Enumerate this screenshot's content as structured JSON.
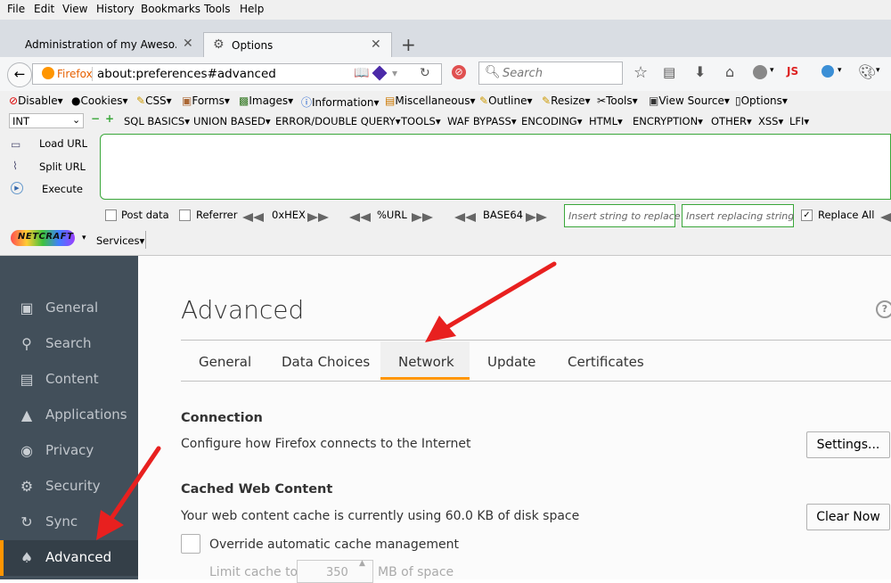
{
  "menu": [
    "File",
    "Edit",
    "View",
    "History",
    "Bookmarks",
    "Tools",
    "Help"
  ],
  "tabs": [
    {
      "title": "Administration of my Aweso...",
      "close": "✕"
    },
    {
      "title": "Options",
      "close": "✕"
    }
  ],
  "new_tab": "+",
  "nav": {
    "identity": "Firefox",
    "url": "about:preferences#advanced",
    "search_placeholder": "Search"
  },
  "webdev": [
    "Disable▾",
    "Cookies▾",
    "CSS▾",
    "Forms▾",
    "Images▾",
    "Information▾",
    "Miscellaneous▾",
    "Outline▾",
    "Resize▾",
    "Tools▾",
    "View Source▾",
    "Options▾"
  ],
  "hackbar": {
    "select_value": "INT",
    "menus": [
      "SQL BASICS▾",
      "UNION BASED▾",
      "ERROR/DOUBLE QUERY▾",
      "TOOLS▾",
      "WAF BYPASS▾",
      "ENCODING▾",
      "HTML▾",
      "ENCRYPTION▾",
      "OTHER▾",
      "XSS▾",
      "LFI▾"
    ],
    "actions": [
      "Load URL",
      "Split URL",
      "Execute"
    ],
    "url_value": "",
    "post_data": "Post data",
    "referrer": "Referrer",
    "hex": "0xHEX",
    "url_enc": "%URL",
    "base64": "BASE64",
    "insert_placeholder": "Insert string to replace",
    "replacing_placeholder": "Insert replacing string",
    "replace_all": "Replace All"
  },
  "netcraft": {
    "logo": "NETCRAFT",
    "services": "Services▾"
  },
  "sidebar": [
    {
      "label": "General",
      "icon": "general-icon"
    },
    {
      "label": "Search",
      "icon": "search-icon"
    },
    {
      "label": "Content",
      "icon": "content-icon"
    },
    {
      "label": "Applications",
      "icon": "applications-icon"
    },
    {
      "label": "Privacy",
      "icon": "privacy-mask-icon"
    },
    {
      "label": "Security",
      "icon": "security-icon"
    },
    {
      "label": "Sync",
      "icon": "sync-icon"
    },
    {
      "label": "Advanced",
      "icon": "advanced-wizard-icon",
      "selected": true
    }
  ],
  "main": {
    "title": "Advanced",
    "help": "?",
    "subtabs": [
      "General",
      "Data Choices",
      "Network",
      "Update",
      "Certificates"
    ],
    "selected_subtab": "Network",
    "connection_heading": "Connection",
    "connection_desc": "Configure how Firefox connects to the Internet",
    "settings_button": "Settings...",
    "cache_heading": "Cached Web Content",
    "cache_desc": "Your web content cache is currently using 60.0 KB of disk space",
    "clear_button": "Clear Now",
    "override_label": "Override automatic cache management",
    "limit_label": "Limit cache to",
    "limit_value": "350",
    "limit_unit": "MB of space"
  },
  "colors": {
    "accent": "#ff9500",
    "sidebar": "#424f5a",
    "annotation": "#e8201f",
    "hackbar_green": "#3aa73a"
  }
}
